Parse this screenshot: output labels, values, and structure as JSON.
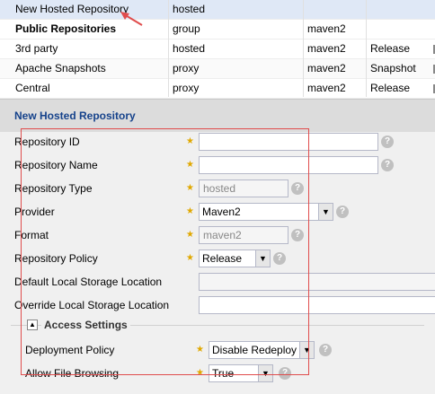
{
  "grid": {
    "rows": [
      {
        "name": "New Hosted Repository",
        "type": "hosted",
        "format": "",
        "policy": ""
      },
      {
        "name": "Public Repositories",
        "type": "group",
        "format": "maven2",
        "policy": ""
      },
      {
        "name": "3rd party",
        "type": "hosted",
        "format": "maven2",
        "policy": "Release"
      },
      {
        "name": "Apache Snapshots",
        "type": "proxy",
        "format": "maven2",
        "policy": "Snapshot"
      },
      {
        "name": "Central",
        "type": "proxy",
        "format": "maven2",
        "policy": "Release"
      }
    ]
  },
  "form": {
    "title": "New Hosted Repository",
    "labels": {
      "repo_id": "Repository ID",
      "repo_name": "Repository Name",
      "repo_type": "Repository Type",
      "provider": "Provider",
      "format": "Format",
      "repo_policy": "Repository Policy",
      "default_storage": "Default Local Storage Location",
      "override_storage": "Override Local Storage Location"
    },
    "values": {
      "repo_id": "",
      "repo_name": "",
      "repo_type": "hosted",
      "provider": "Maven2",
      "format": "maven2",
      "repo_policy": "Release",
      "default_storage": "",
      "override_storage": ""
    },
    "access": {
      "title": "Access Settings",
      "deployment_label": "Deployment Policy",
      "deployment_value": "Disable Redeploy",
      "browsing_label": "Allow File Browsing",
      "browsing_value": "True"
    }
  },
  "icons": {
    "help": "help-icon",
    "required": "required-star-icon",
    "dropdown": "dropdown-arrow-icon",
    "collapse": "collapse-icon",
    "annotation_arrow": "annotation-arrow-icon"
  },
  "colors": {
    "selected_row": "#dfe8f6",
    "required_star": "#e0a800",
    "annotation": "#e04c4c"
  }
}
